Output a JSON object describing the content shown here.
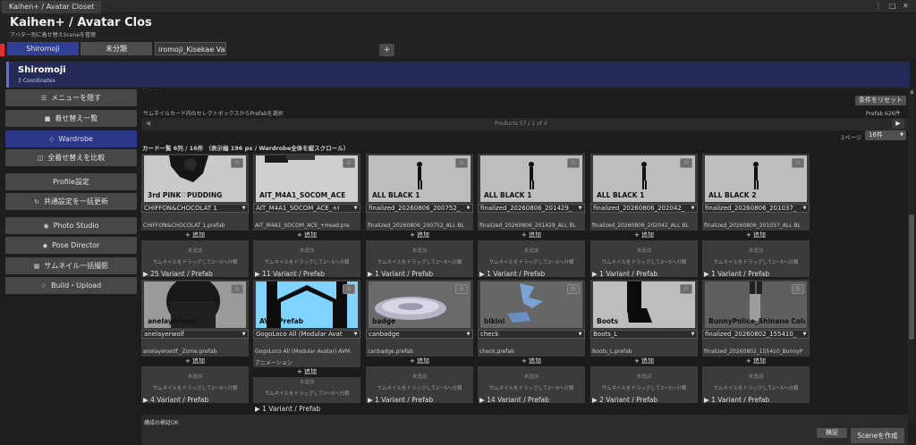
{
  "window": {
    "tab_title": "Kaihen+ / Avatar Closet",
    "controls": [
      "⋮",
      "□",
      "✕"
    ]
  },
  "header": {
    "title": "Kaihen+ / Avatar Clos",
    "subtitle": "アバター別に着せ替えSceneを管理",
    "tabs": [
      {
        "label": "Shiromoji",
        "active": true
      },
      {
        "label": "未分類",
        "active": false
      }
    ],
    "tab_input_value": "iromoji_Kisekae Varia",
    "add_tab_label": "+"
  },
  "banner": {
    "title": "Shiromoji",
    "subtitle": "3 Coordinates"
  },
  "sidebar": {
    "items": [
      {
        "icon": "☰",
        "label": "メニューを隠す",
        "active": false
      },
      {
        "icon": "■",
        "label": "着せ替え一覧",
        "active": false
      },
      {
        "icon": "◇",
        "label": "Wardrobe",
        "active": true
      },
      {
        "icon": "◫",
        "label": "全着せ替えを比較",
        "active": false
      },
      {
        "icon": "",
        "label": "Profile設定",
        "active": false
      },
      {
        "icon": "↻",
        "label": "共通設定を一括更新",
        "active": false
      },
      {
        "icon": "◉",
        "label": "Photo Studio",
        "active": false
      },
      {
        "icon": "◆",
        "label": "Pose Director",
        "active": false
      },
      {
        "icon": "▦",
        "label": "サムネイル一括撮影",
        "active": false
      },
      {
        "icon": "☆",
        "label": "Build・Upload",
        "active": false
      }
    ]
  },
  "toolbar": {
    "clipped_text": "- . . . . .",
    "reset_filter_label": "条件をリセット",
    "hint": "サムネイルカード内のセレクトボックスからPrefabを選択",
    "prefab_count": "Prefab 626件"
  },
  "pager": {
    "prev": "◀",
    "next": "▶",
    "status": "Products 57  /  1 of 4"
  },
  "list": {
    "heading": "カード一覧  6列 / 16件  （表示幅 196 px / Wardrobe全体を縦スクロール）",
    "per_page_label": "1ページ",
    "per_page_value": "16件"
  },
  "card_common": {
    "add_label": "+ 追加",
    "status_text": "未追加",
    "drag_hint": "サムネイルをドラッグして2〜5へ分類",
    "star": "☆",
    "arrow": "▼"
  },
  "cards": [
    {
      "name": "3rd PINK♡PUDDING",
      "selected": "CHIFFON&CHOCOLAT 1",
      "prefab": "CHIFFON&CHOCOLAT 1.prefab",
      "prefab2": "",
      "variants": "▶ 25 Variant / Prefab",
      "thumb": "dark",
      "icon": "outfit-thumbnail-icon"
    },
    {
      "name": "AIT_M4A1_SOCOM_ACE",
      "selected": "AIT_M4A1_SOCOM_ACE_+I",
      "prefab": "AIT_M4A1_SOCOM_ACE_+Head.pre",
      "prefab2": "",
      "variants": "▶ 11 Variant / Prefab",
      "thumb": "rifle",
      "icon": "rifle-thumbnail-icon"
    },
    {
      "name": "ALL BLACK 1",
      "selected": "finalized_20260806_200752_",
      "prefab": "finalized_20260806_200752_ALL BL",
      "prefab2": "",
      "variants": "▶ 1 Variant / Prefab",
      "thumb": "figure",
      "icon": "figure-thumbnail-icon"
    },
    {
      "name": "ALL BLACK 1",
      "selected": "finalized_20260806_201429_",
      "prefab": "finalized_20260806_201429_ALL BL",
      "prefab2": "",
      "variants": "▶ 1 Variant / Prefab",
      "thumb": "figure",
      "icon": "figure-thumbnail-icon"
    },
    {
      "name": "ALL BLACK 1",
      "selected": "finalized_20260806_202042_",
      "prefab": "finalized_20260806_202042_ALL BL",
      "prefab2": "",
      "variants": "▶ 1 Variant / Prefab",
      "thumb": "figure",
      "icon": "figure-thumbnail-icon"
    },
    {
      "name": "ALL BLACK 2",
      "selected": "finalized_20260806_201037_",
      "prefab": "finalized_20260806_201037_ALL BL",
      "prefab2": "",
      "variants": "▶ 1 Variant / Prefab",
      "thumb": "figure",
      "icon": "figure-thumbnail-icon"
    },
    {
      "name": "anelayerwolf",
      "selected": "anelayerwolf",
      "prefab": "anelayerwolf _Zome.prefab",
      "prefab2": "",
      "variants": "▶ 4 Variant / Prefab",
      "thumb": "hair",
      "icon": "hair-thumbnail-icon"
    },
    {
      "name": "AVM Prefab",
      "selected": "GogoLoco All (Modular Avat",
      "prefab": "GogoLoco All (Modular Avatar) AVM.",
      "prefab2": "アニメーション",
      "variants": "▶ 1 Variant / Prefab",
      "thumb": "avm",
      "icon": "avm-thumbnail-icon"
    },
    {
      "name": "badge",
      "selected": "canbadge",
      "prefab": "canbadge.prefab",
      "prefab2": "",
      "variants": "▶ 1 Variant / Prefab",
      "thumb": "badge",
      "icon": "badge-thumbnail-icon"
    },
    {
      "name": "bikini",
      "selected": "check",
      "prefab": "check.prefab",
      "prefab2": "",
      "variants": "▶ 14 Variant / Prefab",
      "thumb": "bikini",
      "icon": "bikini-thumbnail-icon"
    },
    {
      "name": "Boots",
      "selected": "Boots_L",
      "prefab": "Boots_L.prefab",
      "prefab2": "",
      "variants": "▶ 2 Variant / Prefab",
      "thumb": "boots",
      "icon": "boots-thumbnail-icon"
    },
    {
      "name": "BunnyPolice_Shinano Colo",
      "selected": "finalized_20260802_155410_",
      "prefab": "finalized_20260802_155410_BunnyP",
      "prefab2": "",
      "variants": "▶ 1 Variant / Prefab",
      "thumb": "bunny",
      "icon": "bunny-thumbnail-icon"
    }
  ],
  "footer": {
    "status": "構成の検証OK",
    "validate_label": "検証",
    "create_scene_label": "Sceneを作成"
  }
}
